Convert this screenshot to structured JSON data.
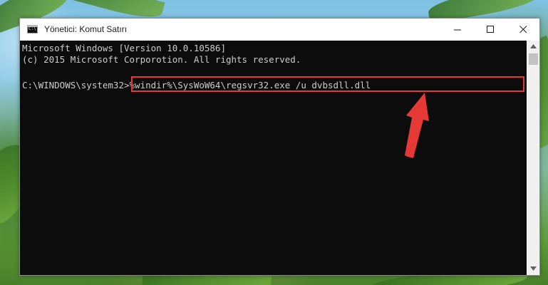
{
  "window": {
    "title": "Yönetici: Komut Satırı",
    "icon": "cmd-icon",
    "icon_text": "C:\\"
  },
  "controls": {
    "minimize": "minimize-icon",
    "maximize": "maximize-icon",
    "close": "close-icon"
  },
  "console": {
    "lines": [
      "Microsoft Windows [Version 10.0.10586]",
      "(c) 2015 Microsoft Corporotion. All rights reserved."
    ],
    "prompt": "C:\\WINDOWS\\system32>",
    "command": "%windir%\\SysWoW64\\regsvr32.exe /u dvbsdll.dll",
    "text_color": "#cccccc",
    "background": "#0c0c0c"
  },
  "annotation": {
    "highlight_color": "#e53935",
    "arrow_icon": "red-arrow-icon"
  }
}
